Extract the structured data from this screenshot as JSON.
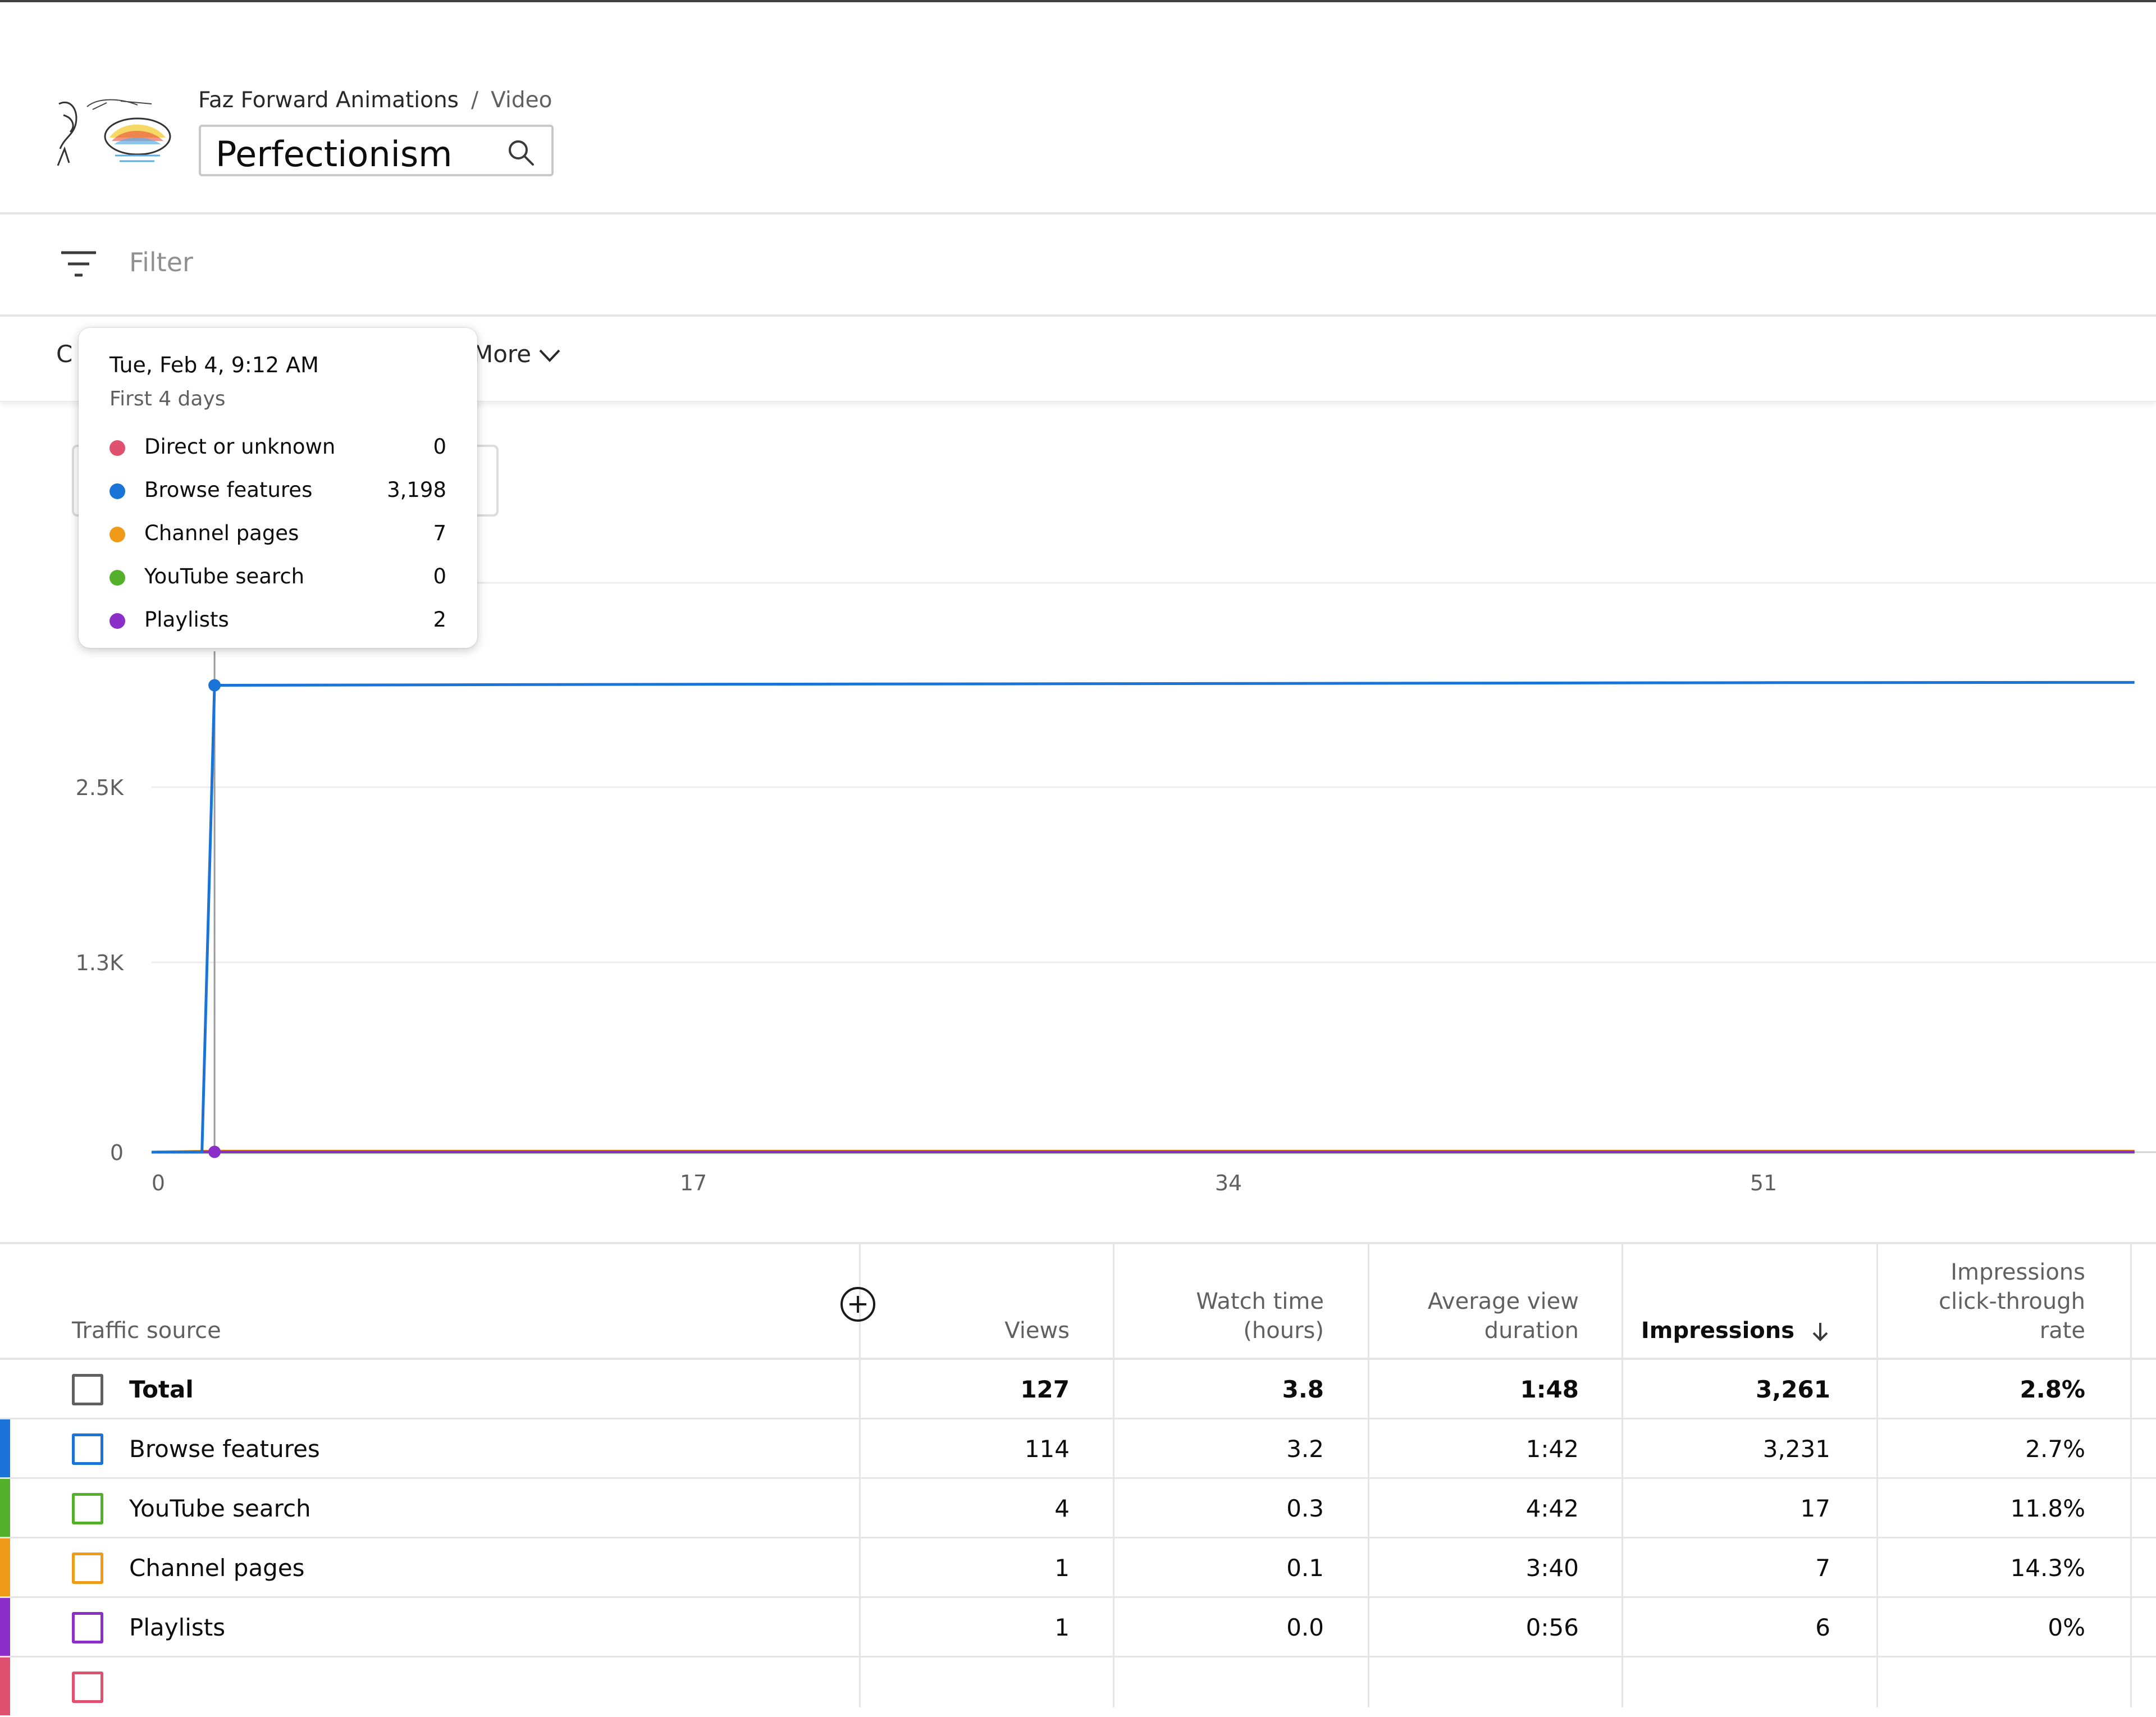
{
  "header": {
    "channel_name": "Faz Forward Animations",
    "breadcrumb_separator": "/",
    "breadcrumb_section": "Video",
    "video_title": "Perfectionism"
  },
  "filter": {
    "label": "Filter"
  },
  "tabs": {
    "partial_first": "C",
    "more_label": "More"
  },
  "tooltip": {
    "date": "Tue, Feb 4, 9:12 AM",
    "subtitle": "First 4 days",
    "rows": [
      {
        "name": "Direct or unknown",
        "value": "0",
        "color": "#e0506f"
      },
      {
        "name": "Browse features",
        "value": "3,198",
        "color": "#1a73d6"
      },
      {
        "name": "Channel pages",
        "value": "7",
        "color": "#f09a1a"
      },
      {
        "name": "YouTube search",
        "value": "0",
        "color": "#52b02a"
      },
      {
        "name": "Playlists",
        "value": "2",
        "color": "#8b2fc9"
      }
    ]
  },
  "chart_data": {
    "type": "line",
    "y_tick_labels": [
      "0",
      "1.3K",
      "2.5K"
    ],
    "x_tick_labels": [
      "0",
      "17",
      "34",
      "51"
    ],
    "ylim": [
      0,
      3700
    ],
    "xlim": [
      0,
      63
    ],
    "highlight_x": 2,
    "series": [
      {
        "name": "Browse features",
        "color": "#1a73d6",
        "x": [
          0,
          1.6,
          2,
          17,
          34,
          51,
          63
        ],
        "y": [
          0,
          0,
          3198,
          3205,
          3210,
          3216,
          3218
        ]
      },
      {
        "name": "Channel pages",
        "color": "#f09a1a",
        "x": [
          0,
          2,
          63
        ],
        "y": [
          0,
          7,
          7
        ]
      },
      {
        "name": "Direct or unknown",
        "color": "#e0506f",
        "x": [
          0,
          2,
          63
        ],
        "y": [
          0,
          0,
          0
        ]
      },
      {
        "name": "YouTube search",
        "color": "#52b02a",
        "x": [
          0,
          2,
          63
        ],
        "y": [
          0,
          0,
          0
        ]
      },
      {
        "name": "Playlists",
        "color": "#8b2fc9",
        "x": [
          0,
          2,
          63
        ],
        "y": [
          0,
          2,
          2
        ]
      }
    ]
  },
  "table": {
    "headers": {
      "traffic_source": "Traffic source",
      "views": "Views",
      "watch_time_line1": "Watch time",
      "watch_time_line2": "(hours)",
      "avd_line1": "Average view",
      "avd_line2": "duration",
      "impressions": "Impressions",
      "ctr_line1": "Impressions",
      "ctr_line2": "click-through",
      "ctr_line3": "rate"
    },
    "rows": [
      {
        "name": "Total",
        "views": "127",
        "watch_time": "3.8",
        "avd": "1:48",
        "impressions": "3,261",
        "ctr": "2.8%",
        "color": "#606060"
      },
      {
        "name": "Browse features",
        "views": "114",
        "watch_time": "3.2",
        "avd": "1:42",
        "impressions": "3,231",
        "ctr": "2.7%",
        "color": "#1a73d6"
      },
      {
        "name": "YouTube search",
        "views": "4",
        "watch_time": "0.3",
        "avd": "4:42",
        "impressions": "17",
        "ctr": "11.8%",
        "color": "#52b02a"
      },
      {
        "name": "Channel pages",
        "views": "1",
        "watch_time": "0.1",
        "avd": "3:40",
        "impressions": "7",
        "ctr": "14.3%",
        "color": "#f09a1a"
      },
      {
        "name": "Playlists",
        "views": "1",
        "watch_time": "0.0",
        "avd": "0:56",
        "impressions": "6",
        "ctr": "0%",
        "color": "#8b2fc9"
      },
      {
        "name": "",
        "views": "",
        "watch_time": "",
        "avd": "",
        "impressions": "",
        "ctr": "",
        "color": "#e0506f"
      }
    ]
  }
}
